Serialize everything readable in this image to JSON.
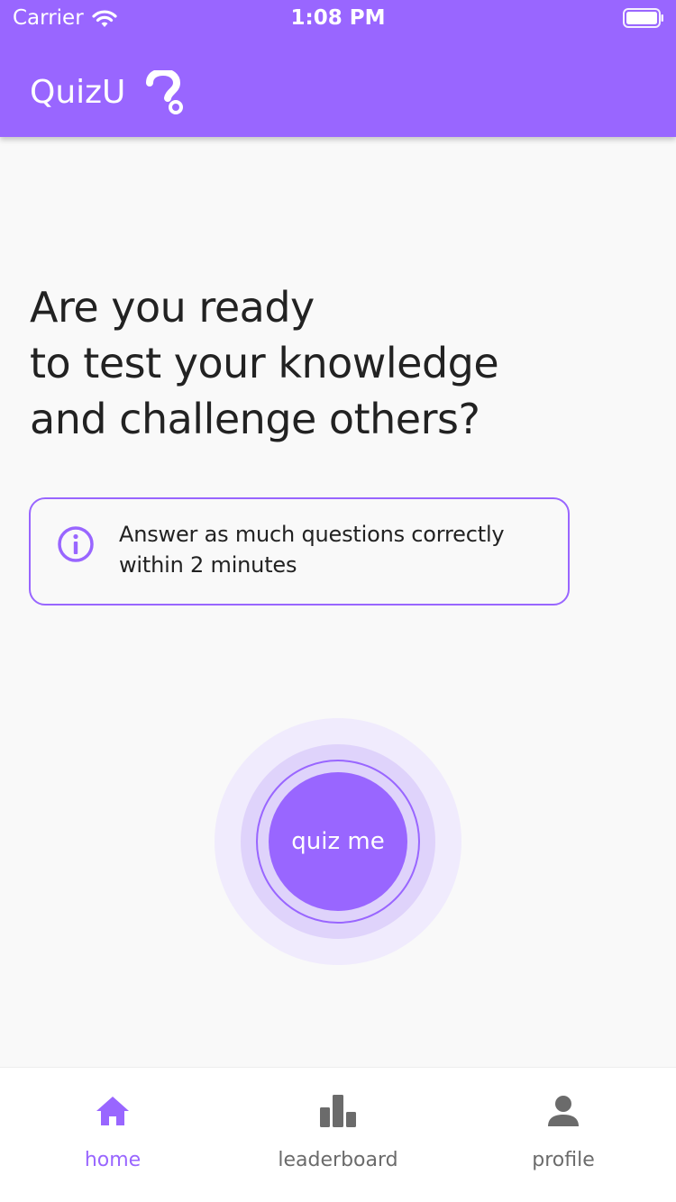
{
  "status_bar": {
    "carrier": "Carrier",
    "time": "1:08 PM",
    "wifi_icon": "wifi-icon",
    "battery_icon": "battery-icon"
  },
  "app_bar": {
    "title": "QuizU",
    "logo_icon": "question-mark-icon"
  },
  "headline": {
    "lines": [
      "Are you ready",
      "to test your knowledge",
      "and challenge others?"
    ]
  },
  "info_box": {
    "icon": "info-icon",
    "lines": [
      "Answer as much questions correctly",
      "within 2 minutes"
    ]
  },
  "quiz_button": {
    "label": "quiz me"
  },
  "bottom_nav": {
    "items": [
      {
        "label": "home",
        "icon": "home-icon",
        "active": true
      },
      {
        "label": "leaderboard",
        "icon": "bar-chart-icon",
        "active": false
      },
      {
        "label": "profile",
        "icon": "person-icon",
        "active": false
      }
    ]
  },
  "colors": {
    "accent": "#9966ff",
    "background": "#f9f9f9",
    "text": "#222222",
    "nav_inactive": "#6b6b6b"
  }
}
